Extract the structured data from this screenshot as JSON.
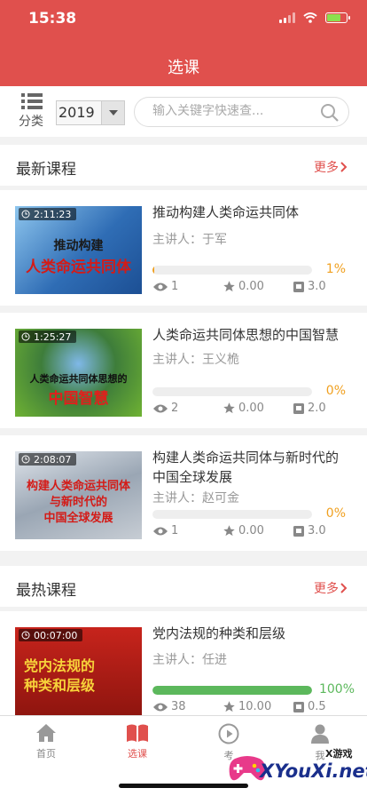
{
  "status_bar": {
    "time": "15:38"
  },
  "header": {
    "title": "选课"
  },
  "filter": {
    "category_label": "分类",
    "year": "2019",
    "search_placeholder": "输入关键字快速查..."
  },
  "sections": {
    "latest": {
      "title": "最新课程",
      "more": "更多"
    },
    "hottest": {
      "title": "最热课程",
      "more": "更多"
    }
  },
  "latest_courses": [
    {
      "title": "推动构建人类命运共同体",
      "teacher": "主讲人：于军",
      "duration": "2:11:23",
      "progress": 1,
      "progress_text": "1%",
      "views": "1",
      "rating": "0.00",
      "credit": "3.0",
      "thumb_caption_1": "推动构建",
      "thumb_caption_2": "人类命运共同体",
      "thumb_color": "#2f6db5"
    },
    {
      "title": "人类命运共同体思想的中国智慧",
      "teacher": "主讲人：王义桅",
      "duration": "1:25:27",
      "progress": 0,
      "progress_text": "0%",
      "views": "2",
      "rating": "0.00",
      "credit": "2.0",
      "thumb_caption_1": "人类命运共同体思想的",
      "thumb_caption_2": "中国智慧",
      "thumb_color": "#4f9a2e"
    },
    {
      "title": "构建人类命运共同体与新时代的中国全球发展",
      "teacher": "主讲人：赵可金",
      "duration": "2:08:07",
      "progress": 0,
      "progress_text": "0%",
      "views": "1",
      "rating": "0.00",
      "credit": "3.0",
      "thumb_caption_1": "构建人类命运共同体",
      "thumb_caption_2": "与新时代的",
      "thumb_caption_3": "中国全球发展",
      "thumb_color": "#8a96a6"
    }
  ],
  "hot_courses": [
    {
      "title": "党内法规的种类和层级",
      "teacher": "主讲人：任进",
      "duration": "00:07:00",
      "progress": 100,
      "progress_text": "100%",
      "views": "38",
      "rating": "10.00",
      "credit": "0.5",
      "thumb_caption_1": "党内法规的",
      "thumb_caption_2": "种类和层级",
      "thumb_color": "#b5201a"
    }
  ],
  "tabbar": {
    "home": "首页",
    "courses": "选课",
    "study": "考",
    "mine": "我"
  },
  "watermark": {
    "brand": "XYouXi.net",
    "sub": "X游戏"
  },
  "colors": {
    "brand": "#e0504d",
    "progress_done": "#5cb85c",
    "progress_low": "#f0a020"
  }
}
